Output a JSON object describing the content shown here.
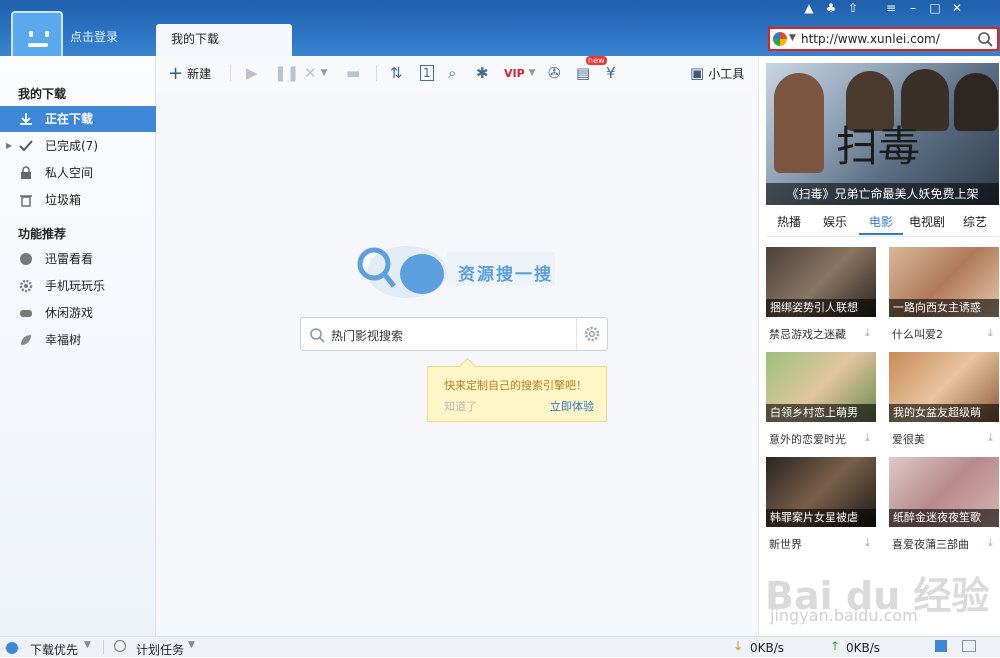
{
  "header": {
    "login_text": "点击登录",
    "tab_label": "我的下载",
    "url": "http://www.xunlei.com/"
  },
  "sidebar": {
    "section1": "我的下载",
    "items1": [
      {
        "label": "正在下载",
        "icon": "download-icon"
      },
      {
        "label": "已完成(7)",
        "icon": "check-icon"
      },
      {
        "label": "私人空间",
        "icon": "lock-icon"
      },
      {
        "label": "垃圾箱",
        "icon": "trash-icon"
      }
    ],
    "section2": "功能推荐",
    "items2": [
      {
        "label": "迅雷看看",
        "icon": "heart-icon"
      },
      {
        "label": "手机玩玩乐",
        "icon": "gear-icon"
      },
      {
        "label": "休闲游戏",
        "icon": "gamepad-icon"
      },
      {
        "label": "幸福树",
        "icon": "leaf-icon"
      }
    ]
  },
  "toolbar": {
    "new_label": "新建",
    "tools_label": "小工具",
    "new_badge": "new"
  },
  "main": {
    "logo_text": "资源搜一搜",
    "search_placeholder": "热门影视搜索",
    "tip_text": "快来定制自己的搜索引擎吧！",
    "tip_dismiss": "知道了",
    "tip_action": "立即体验"
  },
  "right": {
    "banner_logo": "扫毒",
    "banner_caption": "《扫毒》兄弟亡命最美人妖免费上架",
    "tabs": [
      "热播",
      "娱乐",
      "电影",
      "电视剧",
      "综艺"
    ],
    "selected_tab": "电影",
    "movies": [
      {
        "overlay": "捆绑姿势引人联想",
        "title": "禁忌游戏之迷藏"
      },
      {
        "overlay": "一路向西女主诱惑",
        "title": "什么叫爱2"
      },
      {
        "overlay": "白领乡村恋上萌男",
        "title": "意外的恋爱时光"
      },
      {
        "overlay": "我的女盆友超级萌",
        "title": "爱很美"
      },
      {
        "overlay": "韩罪案片女星被虐",
        "title": "新世界"
      },
      {
        "overlay": "纸醉金迷夜夜笙歌",
        "title": "喜爱夜蒲三部曲"
      }
    ]
  },
  "status": {
    "priority": "下载优先",
    "schedule": "计划任务",
    "down_speed": "0KB/s",
    "up_speed": "0KB/s"
  },
  "watermark": {
    "main": "Bai du 经验",
    "sub": "jingyan.baidu.com"
  }
}
